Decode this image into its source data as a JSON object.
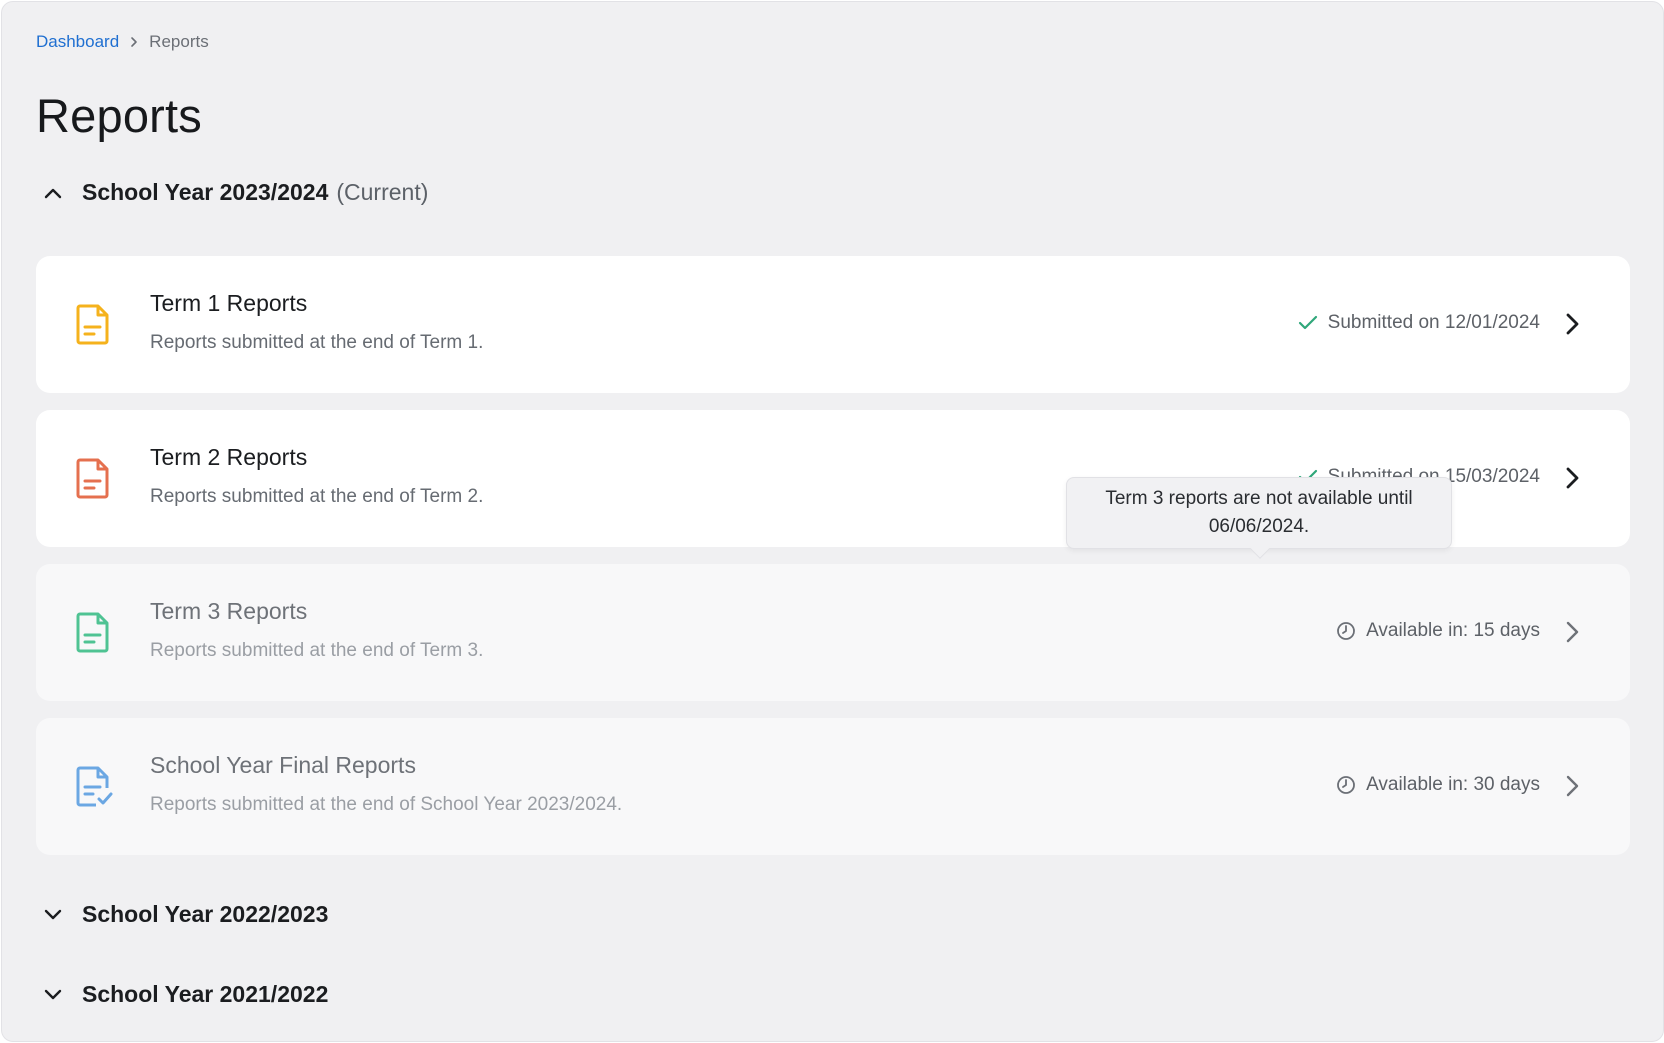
{
  "breadcrumb": {
    "root": "Dashboard",
    "current": "Reports"
  },
  "page": {
    "title": "Reports"
  },
  "years": [
    {
      "title": "School Year 2023/2024",
      "tag": "(Current)",
      "expanded": true,
      "reports": [
        {
          "title": "Term 1 Reports",
          "description": "Reports submitted at the end of Term 1.",
          "status": "Submitted on 12/01/2024",
          "status_type": "submitted",
          "icon": "document-icon",
          "icon_color": "#f5b21c",
          "muted": false
        },
        {
          "title": "Term 2 Reports",
          "description": "Reports submitted at the end of Term 2.",
          "status": "Submitted on 15/03/2024",
          "status_type": "submitted",
          "icon": "document-icon",
          "icon_color": "#e5704f",
          "muted": false
        },
        {
          "title": "Term 3 Reports",
          "description": "Reports submitted at the end of Term 3.",
          "status": "Available in: 15 days",
          "status_type": "pending",
          "icon": "document-icon",
          "icon_color": "#4fc393",
          "muted": true
        },
        {
          "title": "School Year Final Reports",
          "description": "Reports submitted at the end of School Year 2023/2024.",
          "status": "Available in: 30 days",
          "status_type": "pending",
          "icon": "document-check-icon",
          "icon_color": "#6ba7e3",
          "muted": true
        }
      ]
    },
    {
      "title": "School Year 2022/2023",
      "expanded": false
    },
    {
      "title": "School Year 2021/2022",
      "expanded": false
    }
  ],
  "tooltip": {
    "text": "Term 3 reports are not available until 06/06/2024."
  },
  "colors": {
    "link": "#1f6fd1",
    "check": "#2fa77a",
    "background": "#f0f0f2"
  }
}
